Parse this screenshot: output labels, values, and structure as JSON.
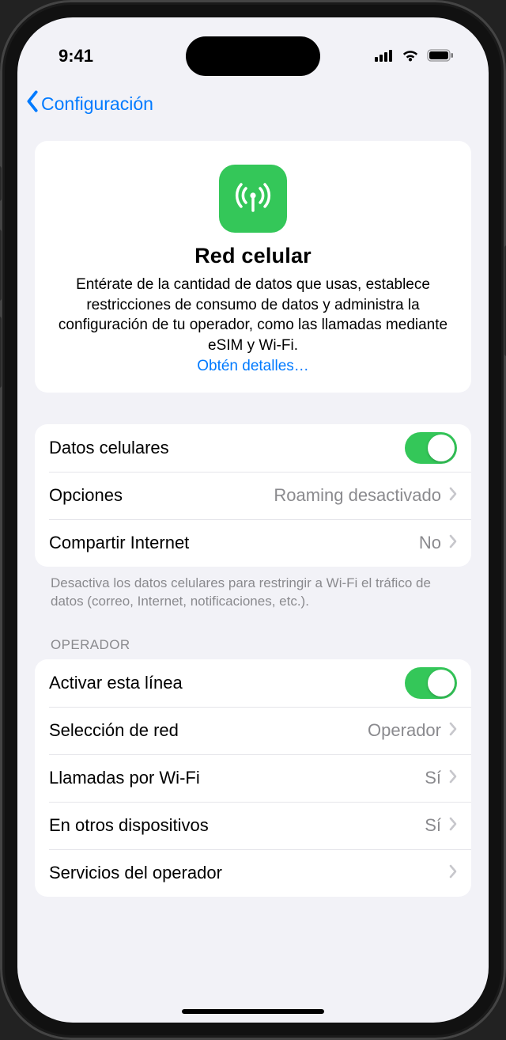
{
  "status": {
    "time": "9:41"
  },
  "nav": {
    "back": "Configuración"
  },
  "hero": {
    "title": "Red celular",
    "description": "Entérate de la cantidad de datos que usas, establece restricciones de consumo de datos y administra la configuración de tu operador, como las llamadas mediante eSIM y Wi-Fi.",
    "link": "Obtén detalles…"
  },
  "group1": {
    "cellular_data": {
      "label": "Datos celulares",
      "on": true
    },
    "options": {
      "label": "Opciones",
      "detail": "Roaming desactivado"
    },
    "hotspot": {
      "label": "Compartir Internet",
      "detail": "No"
    },
    "footnote": "Desactiva los datos celulares para restringir a Wi-Fi el tráfico de datos (correo, Internet, notificaciones, etc.)."
  },
  "carrier": {
    "header": "Operador",
    "activate": {
      "label": "Activar esta línea",
      "on": true
    },
    "network": {
      "label": "Selección de red",
      "detail": "Operador"
    },
    "wifi_calling": {
      "label": "Llamadas por Wi-Fi",
      "detail": "Sí"
    },
    "other_devices": {
      "label": "En otros dispositivos",
      "detail": "Sí"
    },
    "carrier_services": {
      "label": "Servicios del operador",
      "detail": ""
    }
  },
  "colors": {
    "accent": "#007aff",
    "green": "#34c759"
  }
}
